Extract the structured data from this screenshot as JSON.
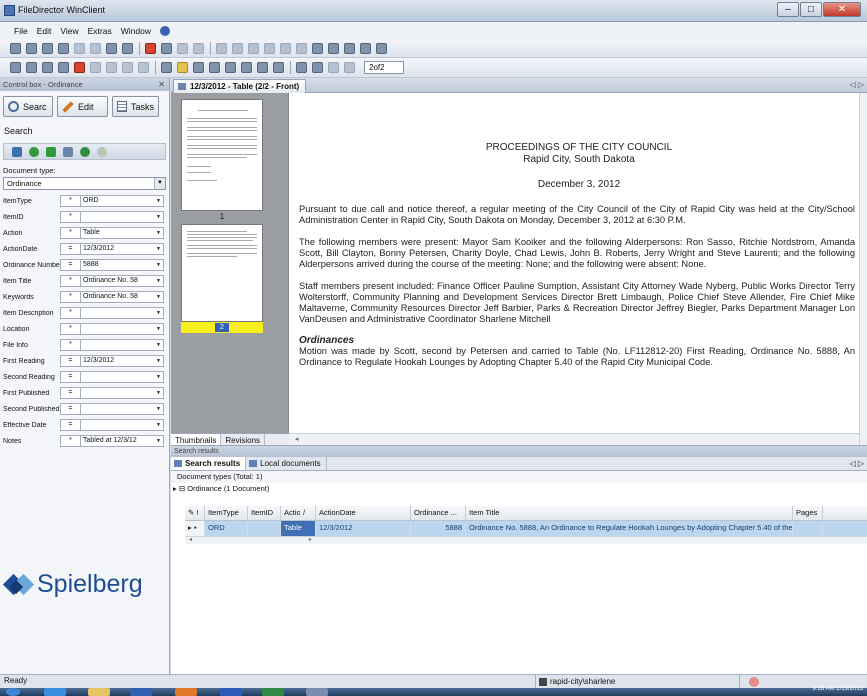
{
  "window": {
    "title": "FileDirector WinClient"
  },
  "menu": [
    "File",
    "Edit",
    "View",
    "Extras",
    "Window"
  ],
  "toolbar": {
    "page_indicator": "2of2"
  },
  "left_panel": {
    "header": "Control box - Ordinance",
    "search_button": "Searc",
    "edit_button": "Edit",
    "tasks_button": "Tasks",
    "search_label": "Search",
    "doctype_label": "Document type:",
    "doctype_value": "Ordinance",
    "fields": [
      {
        "label": "ItemType",
        "op": "*",
        "value": "ORD"
      },
      {
        "label": "ItemID",
        "op": "*",
        "value": ""
      },
      {
        "label": "Action",
        "op": "*",
        "value": "Table"
      },
      {
        "label": "ActionDate",
        "op": "=",
        "value": "12/3/2012"
      },
      {
        "label": "Ordinance Number",
        "op": "=",
        "value": "5888"
      },
      {
        "label": "Item Title",
        "op": "*",
        "value": "Ordinance No. 58"
      },
      {
        "label": "Keywords",
        "op": "*",
        "value": "Ordinance No. 58"
      },
      {
        "label": "Item Description",
        "op": "*",
        "value": ""
      },
      {
        "label": "Location",
        "op": "*",
        "value": ""
      },
      {
        "label": "File Info",
        "op": "*",
        "value": ""
      },
      {
        "label": "First Reading",
        "op": "=",
        "value": "12/3/2012"
      },
      {
        "label": "Second Reading",
        "op": "=",
        "value": ""
      },
      {
        "label": "First Published",
        "op": "=",
        "value": ""
      },
      {
        "label": "Second Published",
        "op": "=",
        "value": ""
      },
      {
        "label": "Effective Date",
        "op": "=",
        "value": ""
      },
      {
        "label": "Notes",
        "op": "*",
        "value": "Tabled at 12/3/12"
      }
    ],
    "logo": "Spielberg"
  },
  "document_tab": {
    "title": "12/3/2012 - Table (2/2 - Front)"
  },
  "thumbnails": {
    "page1": "1",
    "page2": "2",
    "tab_thumbnails": "Thumbnails",
    "tab_revisions": "Revisions"
  },
  "document": {
    "heading1": "PROCEEDINGS OF THE CITY COUNCIL",
    "heading2": "Rapid City, South Dakota",
    "date": "December 3, 2012",
    "para1": "Pursuant to due call and notice thereof, a regular meeting of the City Council of the City of Rapid City was held at the City/School Administration Center in Rapid City, South Dakota on Monday, December 3, 2012 at 6:30 P.M.",
    "para2": "The following members were present: Mayor Sam Kooiker and the following Alderpersons: Ron Sasso, Ritchie Nordstrom, Amanda Scott, Bill Clayton, Bonny Petersen, Charity Doyle, Chad Lewis, John B. Roberts, Jerry Wright and Steve Laurenti; and the following Alderpersons arrived during the course of the meeting: None; and the following were absent: None.",
    "para3": "Staff members present included: Finance Officer Pauline Sumption, Assistant City Attorney Wade Nyberg, Public Works Director Terry Wolterstorff, Community Planning and Development Services Director Brett Limbaugh, Police Chief Steve Allender, Fire Chief Mike Maltaverne, Community Resources Director Jeff Barbier, Parks & Recreation Director Jeffrey Biegler, Parks Department Manager Lon VanDeusen and Administrative Coordinator Sharlene Mitchell",
    "section": "Ordinances",
    "para4": "Motion was made by Scott, second by Petersen and carried to Table (No. LF112812-20) First Reading, Ordinance No. 5888, An Ordinance to Regulate Hookah Lounges by Adopting Chapter 5.40 of the Rapid City Municipal Code."
  },
  "results": {
    "panel_title": "Search results",
    "tab_search": "Search results",
    "tab_local": "Local documents",
    "doctypes_line": "Document types (Total: 1)",
    "group_line": "Ordinance (1 Document)",
    "columns": [
      "ItemType",
      "ItemID",
      "Action",
      "/",
      "ActionDate",
      "Ordinance ...",
      "Item Title",
      "Pages"
    ],
    "row": {
      "itemtype": "ORD",
      "itemid": "",
      "action": "Table",
      "actiondate": "12/3/2012",
      "ordinance": "5888",
      "title": "Ordinance No. 5888, An Ordinance to Regulate Hookah Lounges by Adopting Chapter 5.40 of the Ra",
      "pages": ""
    }
  },
  "status": {
    "ready": "Ready",
    "user": "rapid-city\\sharlene"
  },
  "taskbar": {
    "time": "9:28 AM",
    "date": "2/19/2013"
  }
}
